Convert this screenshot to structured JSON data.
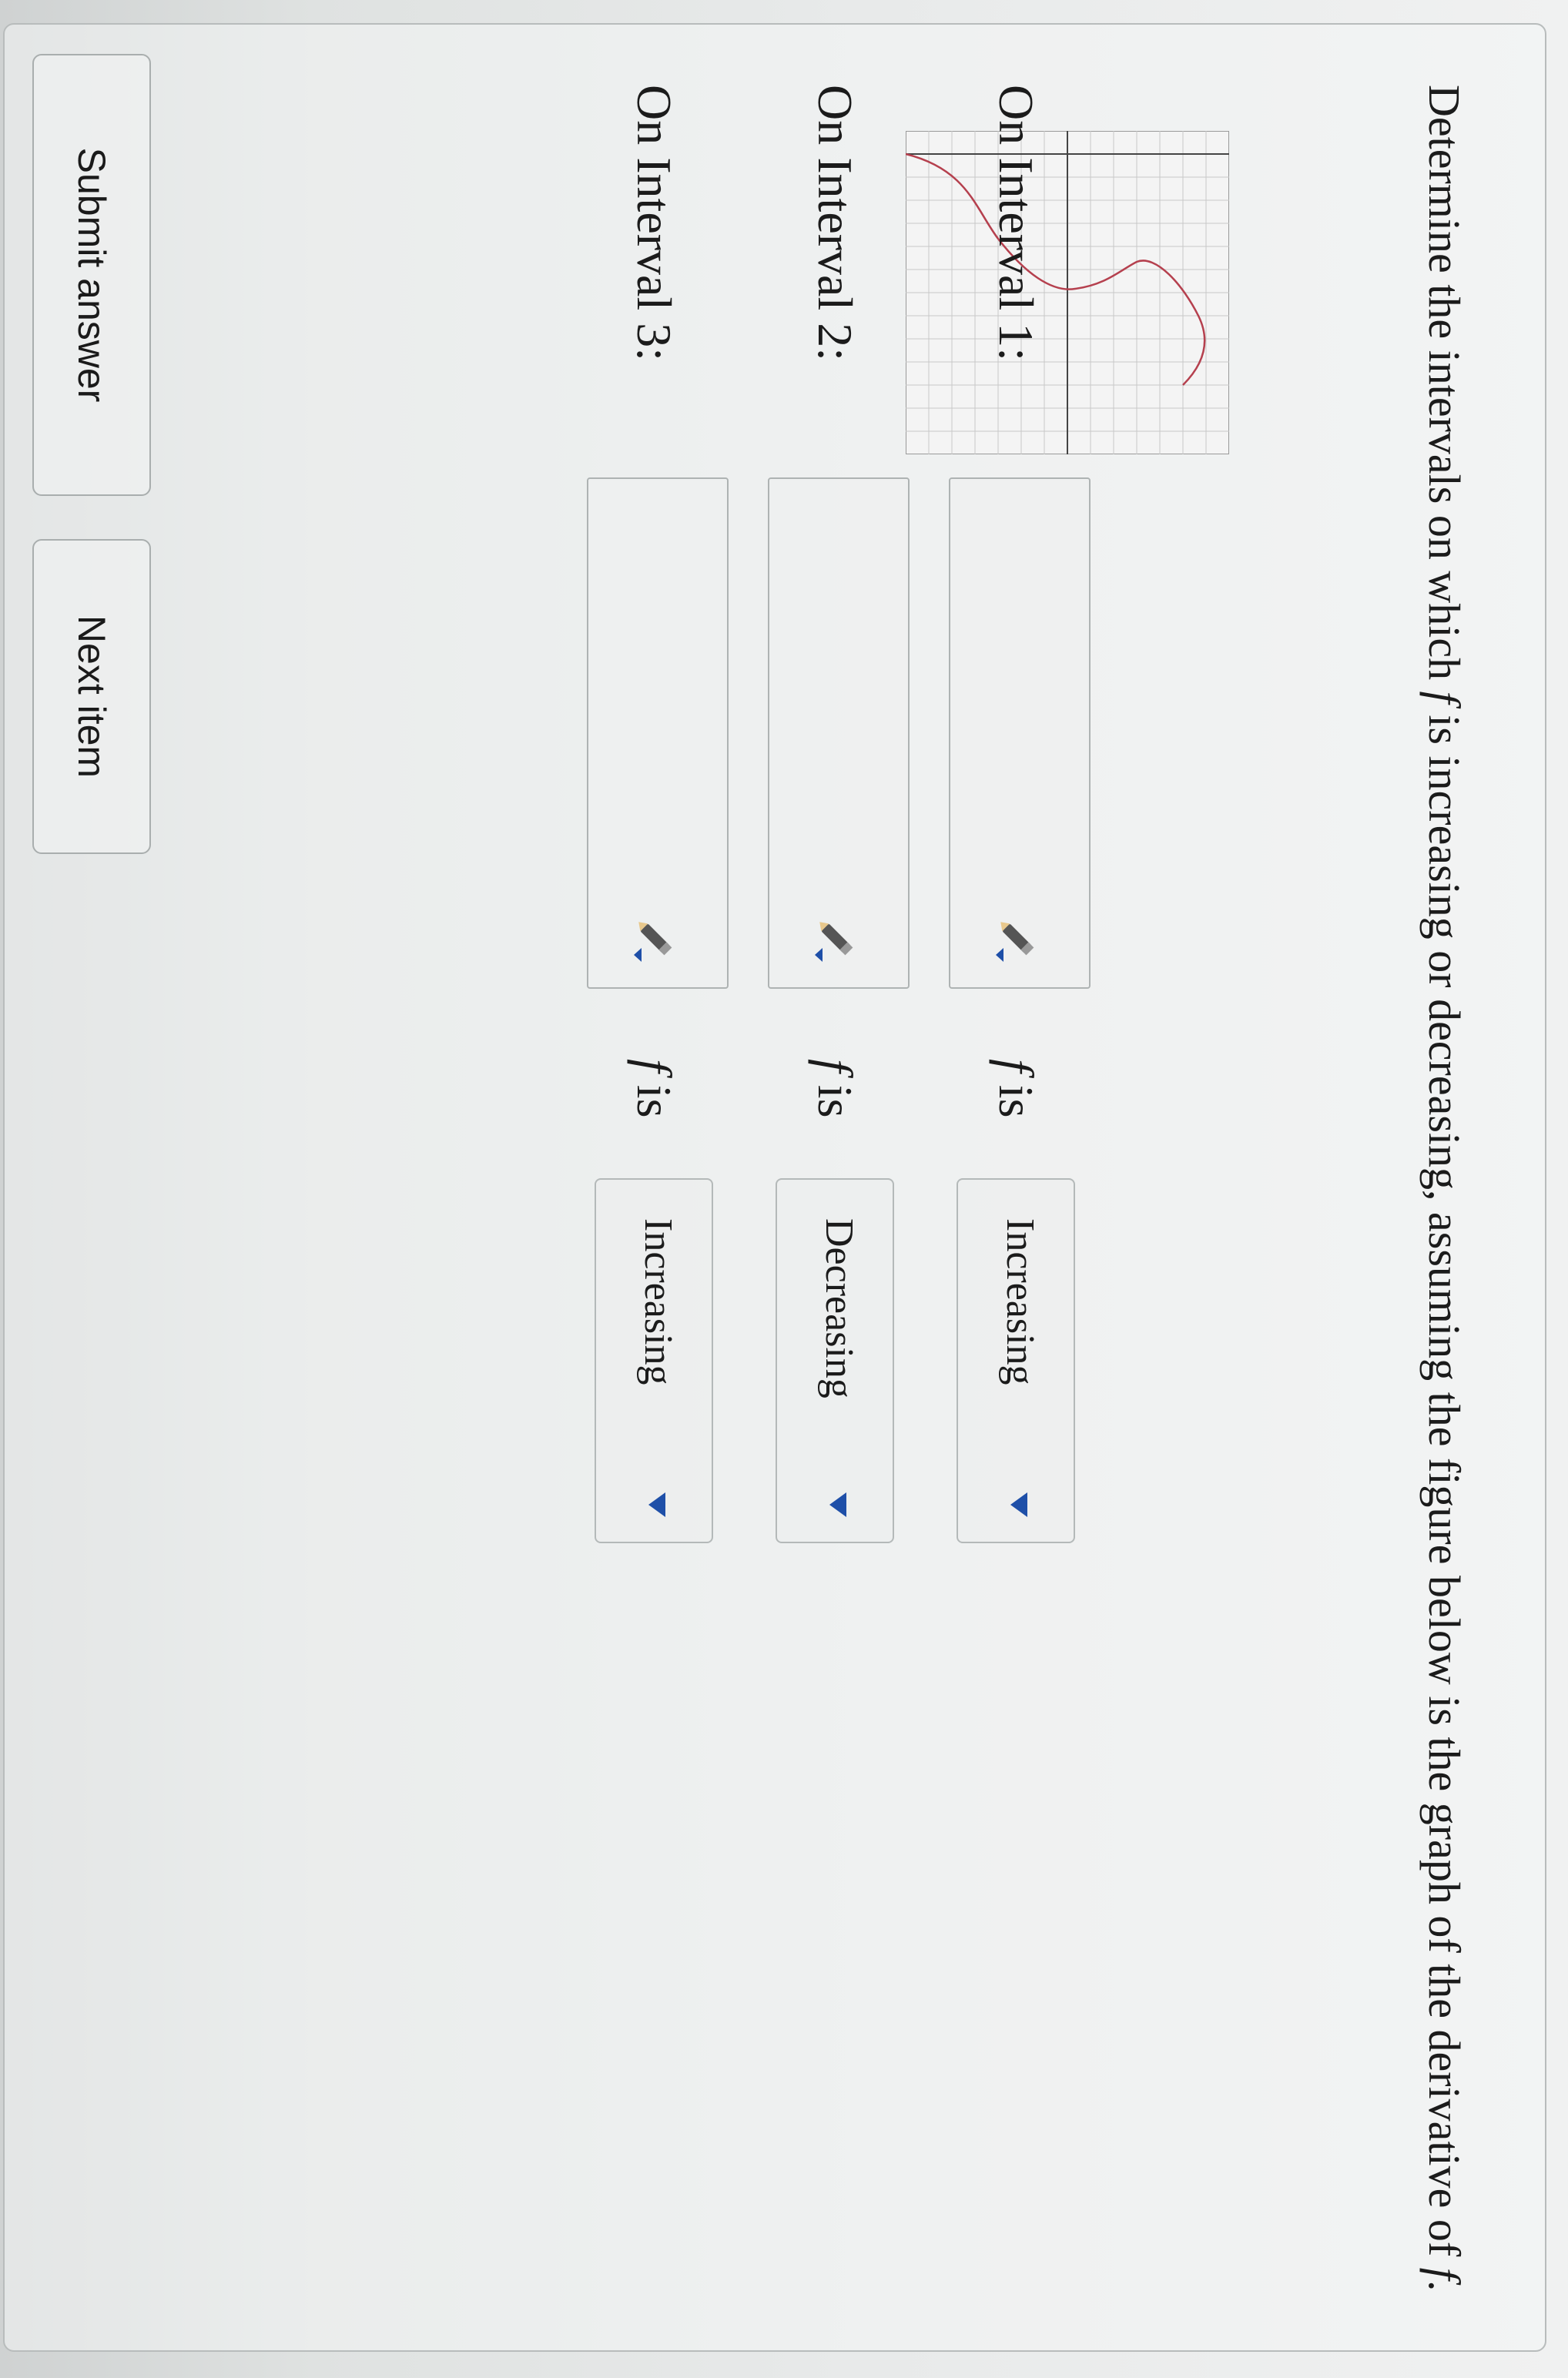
{
  "question": {
    "part1": "Determine the intervals on which ",
    "f1": "f",
    "part2": " is increasing or decreasing, assuming the figure below is the graph of the derivative of ",
    "f2": "f",
    "part3": "."
  },
  "graph": {
    "curve_color": "#b5404e",
    "grid_color": "#c8c8c8",
    "axis_color": "#444444"
  },
  "intervals": [
    {
      "label": "On Interval 1:",
      "f": "f",
      "is": " is",
      "value": "Increasing"
    },
    {
      "label": "On Interval 2:",
      "f": "f",
      "is": " is",
      "value": "Decreasing"
    },
    {
      "label": "On Interval 3:",
      "f": "f",
      "is": " is",
      "value": "Increasing"
    }
  ],
  "buttons": {
    "submit": "Submit answer",
    "next": "Next item"
  },
  "colors": {
    "dropdown_arrow": "#1e4fa8"
  },
  "icons": [
    "pencil-icon",
    "caret-down-icon"
  ]
}
